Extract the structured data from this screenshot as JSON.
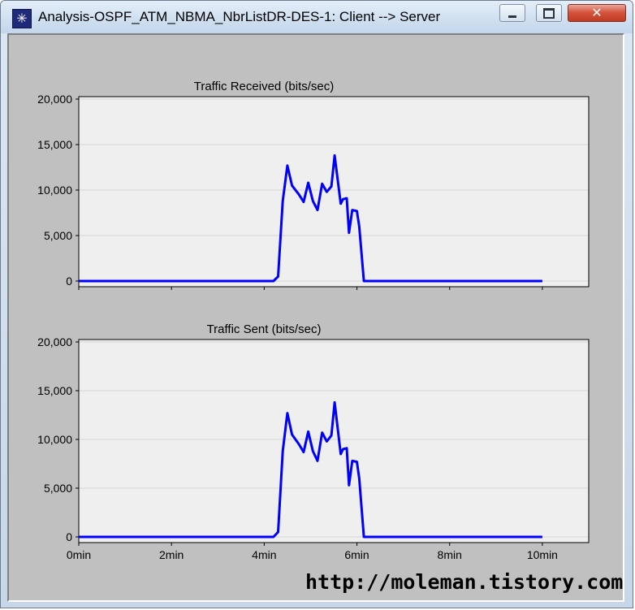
{
  "window": {
    "title": "Analysis-OSPF_ATM_NBMA_NbrListDR-DES-1: Client --> Server",
    "app_icon_glyph": "✳",
    "controls": {
      "minimize": "minimize-icon",
      "maximize": "maximize-icon",
      "close": "close-icon",
      "close_glyph": "✕"
    }
  },
  "colors": {
    "series": "#0000ff",
    "plot_bg": "#efefef",
    "panel_bg": "#c0c0c0",
    "grid": "#d4d4d4"
  },
  "chart_data": [
    {
      "type": "line",
      "title": "Traffic Received (bits/sec)",
      "xlim": [
        0,
        11
      ],
      "ylim": [
        0,
        20000
      ],
      "y_ticks": [
        {
          "v": 20000,
          "label": "20,000"
        },
        {
          "v": 15000,
          "label": "15,000"
        },
        {
          "v": 10000,
          "label": "10,000"
        },
        {
          "v": 5000,
          "label": "5,000"
        },
        {
          "v": 0,
          "label": "0"
        }
      ],
      "grid": true,
      "series": [
        {
          "points": [
            [
              0.0,
              0
            ],
            [
              4.2,
              0
            ],
            [
              4.3,
              500
            ],
            [
              4.4,
              8800
            ],
            [
              4.5,
              12700
            ],
            [
              4.6,
              10500
            ],
            [
              4.75,
              9500
            ],
            [
              4.85,
              8700
            ],
            [
              4.95,
              10800
            ],
            [
              5.05,
              8800
            ],
            [
              5.15,
              7800
            ],
            [
              5.25,
              10700
            ],
            [
              5.35,
              9800
            ],
            [
              5.45,
              10400
            ],
            [
              5.52,
              13800
            ],
            [
              5.65,
              8500
            ],
            [
              5.7,
              9000
            ],
            [
              5.78,
              9100
            ],
            [
              5.83,
              5300
            ],
            [
              5.9,
              7800
            ],
            [
              6.0,
              7700
            ],
            [
              6.05,
              6000
            ],
            [
              6.15,
              0
            ],
            [
              10.0,
              0
            ]
          ]
        }
      ]
    },
    {
      "type": "line",
      "title": "Traffic Sent (bits/sec)",
      "xlim": [
        0,
        11
      ],
      "ylim": [
        0,
        20000
      ],
      "y_ticks": [
        {
          "v": 20000,
          "label": "20,000"
        },
        {
          "v": 15000,
          "label": "15,000"
        },
        {
          "v": 10000,
          "label": "10,000"
        },
        {
          "v": 5000,
          "label": "5,000"
        },
        {
          "v": 0,
          "label": "0"
        }
      ],
      "x_ticks": [
        {
          "v": 0,
          "label": "0min"
        },
        {
          "v": 2,
          "label": "2min"
        },
        {
          "v": 4,
          "label": "4min"
        },
        {
          "v": 6,
          "label": "6min"
        },
        {
          "v": 8,
          "label": "8min"
        },
        {
          "v": 10,
          "label": "10min"
        }
      ],
      "grid": true,
      "series": [
        {
          "points": [
            [
              0.0,
              0
            ],
            [
              4.2,
              0
            ],
            [
              4.3,
              500
            ],
            [
              4.4,
              8800
            ],
            [
              4.5,
              12700
            ],
            [
              4.6,
              10500
            ],
            [
              4.75,
              9500
            ],
            [
              4.85,
              8700
            ],
            [
              4.95,
              10800
            ],
            [
              5.05,
              8800
            ],
            [
              5.15,
              7800
            ],
            [
              5.25,
              10700
            ],
            [
              5.35,
              9800
            ],
            [
              5.45,
              10400
            ],
            [
              5.52,
              13800
            ],
            [
              5.65,
              8500
            ],
            [
              5.7,
              9000
            ],
            [
              5.78,
              9100
            ],
            [
              5.83,
              5300
            ],
            [
              5.9,
              7800
            ],
            [
              6.0,
              7700
            ],
            [
              6.05,
              6000
            ],
            [
              6.15,
              0
            ],
            [
              10.0,
              0
            ]
          ]
        }
      ]
    }
  ],
  "watermark": "http://moleman.tistory.com"
}
